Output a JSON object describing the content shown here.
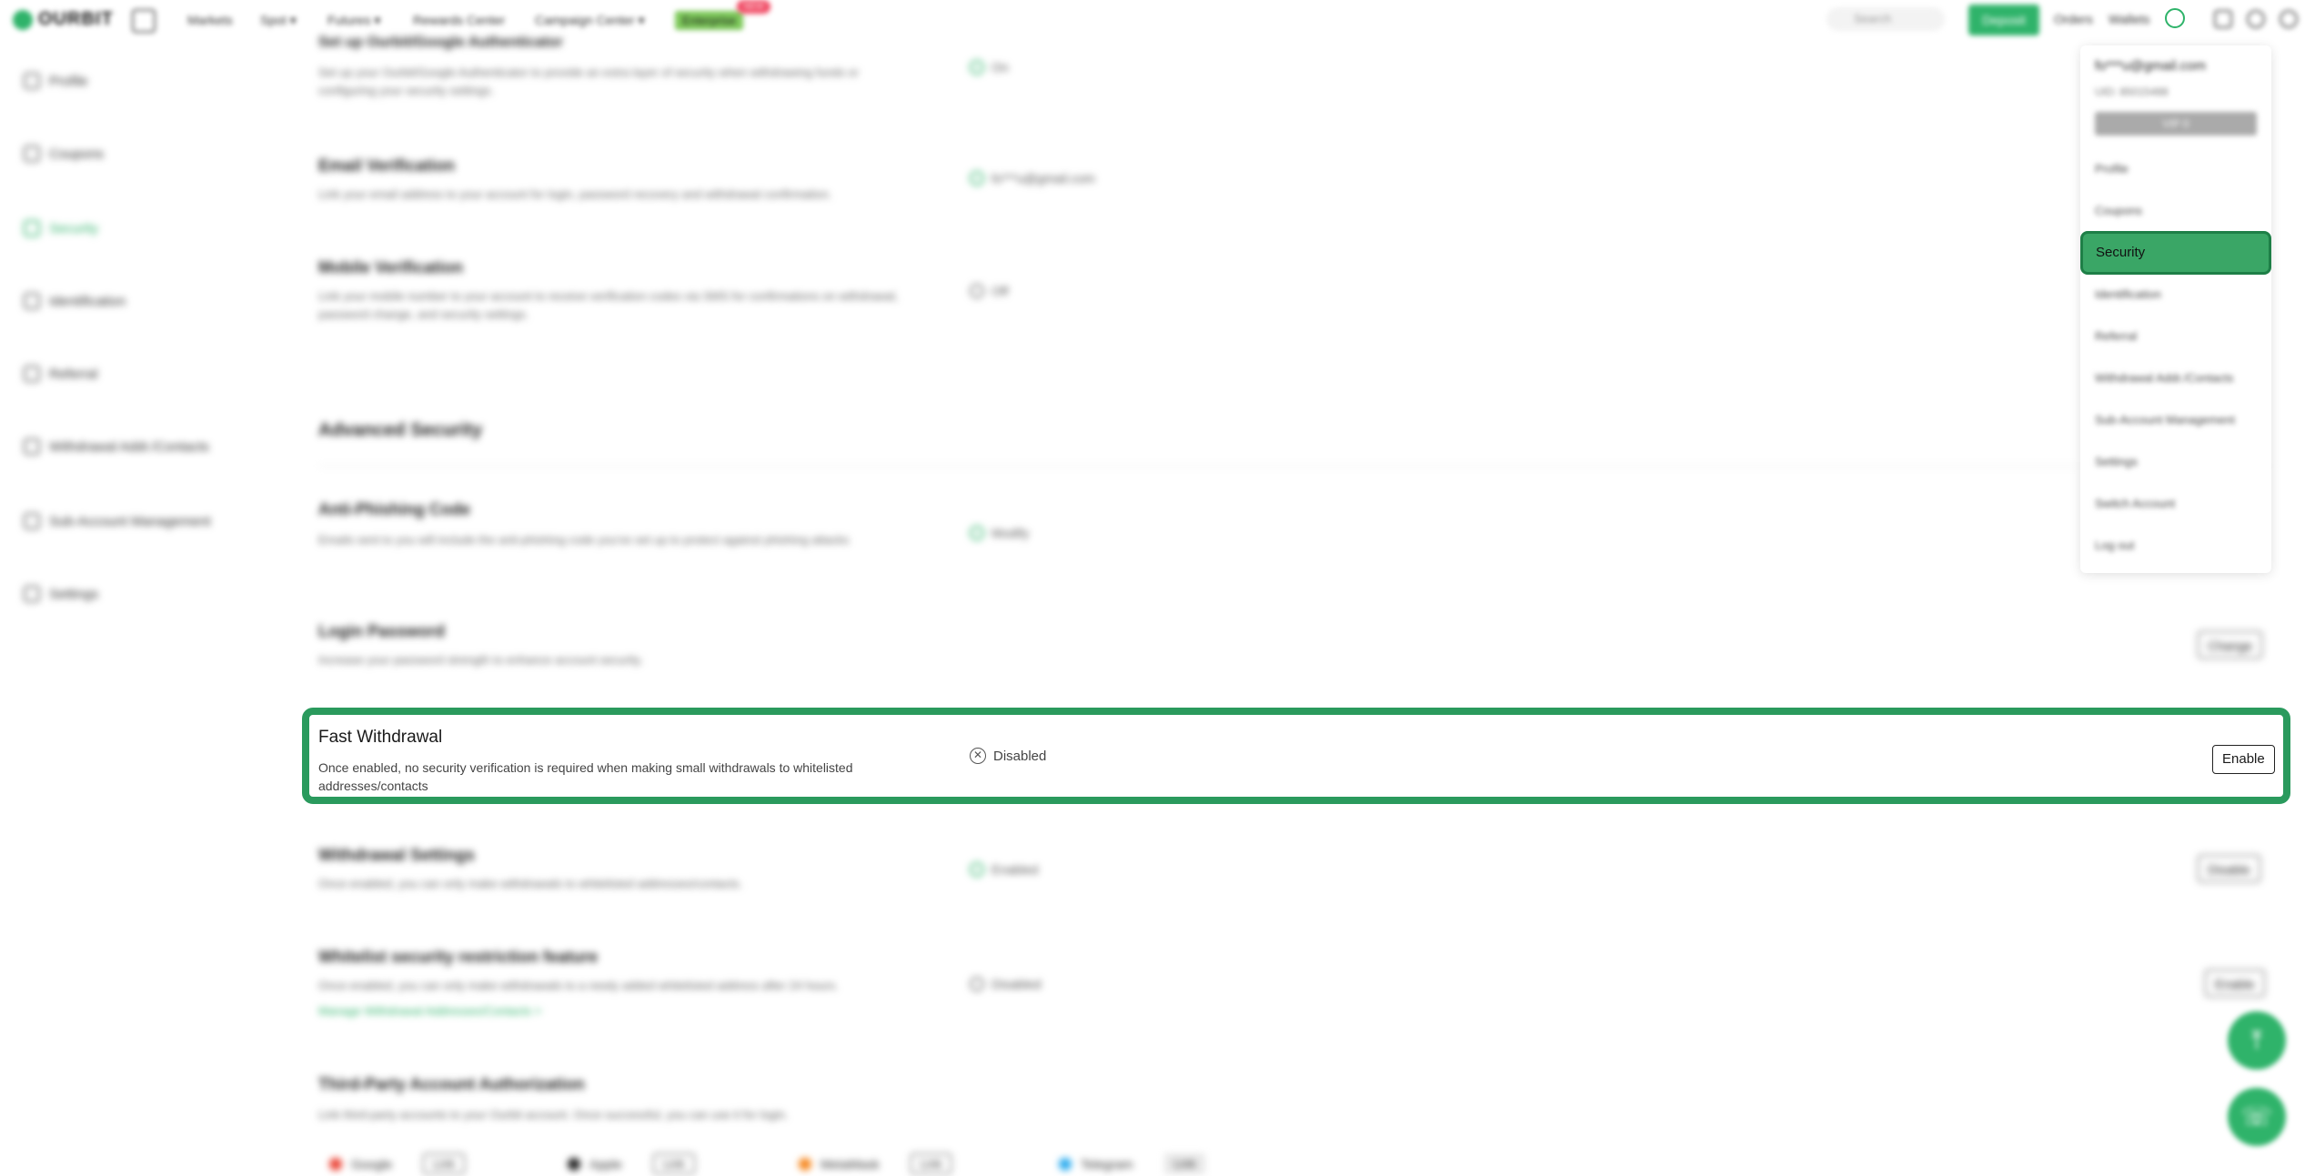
{
  "topnav": {
    "logo": "OURBIT",
    "items": [
      "Markets",
      "Spot ▾",
      "Futures ▾",
      "Rewards Center",
      "Campaign Center ▾"
    ],
    "enterprise": "Enterprise",
    "new_badge": "NEW",
    "search_placeholder": "Search",
    "deposit": "Deposit",
    "orders": "Orders",
    "wallets": "Wallets"
  },
  "sidebar": {
    "items": [
      {
        "label": "Profile"
      },
      {
        "label": "Coupons"
      },
      {
        "label": "Security"
      },
      {
        "label": "Identification"
      },
      {
        "label": "Referral"
      },
      {
        "label": "Withdrawal Addr./Contacts"
      },
      {
        "label": "Sub-Account Management"
      },
      {
        "label": "Settings"
      }
    ]
  },
  "rows": {
    "authenticator": {
      "title": "Set up Ourbit/Google Authenticator",
      "desc": "Set up your Ourbit/Google Authenticator to provide an extra layer of security when withdrawing funds or configuring your security settings.",
      "status": "On"
    },
    "email": {
      "title": "Email Verification",
      "desc": "Link your email address to your account for login, password recovery and withdrawal confirmation.",
      "status": "fo***u@gmail.com"
    },
    "mobile": {
      "title": "Mobile Verification",
      "desc": "Link your mobile number to your account to receive verification codes via SMS for confirmations on withdrawal, password change, and security settings.",
      "status": "Off"
    },
    "advanced_title": "Advanced Security",
    "antiphishing": {
      "title": "Anti-Phishing Code",
      "desc": "Emails sent to you will include the anti-phishing code you've set up to protect against phishing attacks",
      "status": "Modify"
    },
    "login_password": {
      "title": "Login Password",
      "desc": "Increase your password strength to enhance account security.",
      "button": "Change"
    },
    "fast_withdrawal": {
      "title": "Fast Withdrawal",
      "desc": "Once enabled, no security verification is required when making small withdrawals to whitelisted addresses/contacts",
      "status": "Disabled",
      "button": "Enable"
    },
    "withdrawal_settings": {
      "title": "Withdrawal Settings",
      "desc": "Once enabled, you can only make withdrawals to whitelisted addresses/contacts.",
      "status": "Enabled",
      "button": "Disable"
    },
    "whitelist": {
      "title": "Whitelist security restriction feature",
      "desc": "Once enabled, you can only make withdrawals to a newly added whitelisted address after 24 hours.",
      "link": "Manage Withdrawal Addresses/Contacts >",
      "status": "Disabled",
      "button": "Enable"
    },
    "third_party": {
      "title": "Third-Party Account Authorization",
      "desc": "Link third-party accounts to your Ourbit account. Once successful, you can use it for login.",
      "providers": [
        {
          "name": "Google",
          "button": "Link"
        },
        {
          "name": "Apple",
          "button": "Link"
        },
        {
          "name": "MetaMask",
          "button": "Link"
        },
        {
          "name": "Telegram",
          "button": "Link"
        }
      ]
    }
  },
  "dropdown": {
    "email": "fo***u@gmail.com",
    "uid": "UID: 85015488",
    "vip": "VIP 0",
    "items": [
      "Profile",
      "Coupons",
      "Security",
      "Identification",
      "Referral",
      "Withdrawal Addr./Contacts",
      "Sub-Account Management",
      "Settings",
      "Switch Account",
      "Log out"
    ]
  },
  "fabs": {
    "top": "⤒",
    "support": "☏"
  },
  "colors": {
    "accent": "#2fb36a",
    "highlight_border": "#2a9a5d"
  }
}
